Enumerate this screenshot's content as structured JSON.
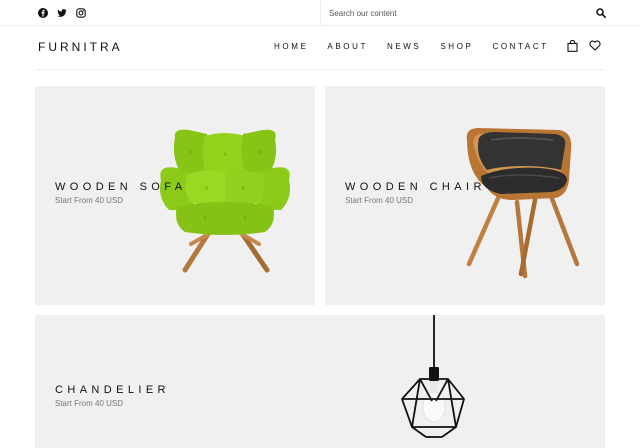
{
  "topbar": {
    "social": [
      "facebook-icon",
      "twitter-icon",
      "instagram-icon"
    ],
    "search": {
      "placeholder": "Search our content",
      "value": ""
    }
  },
  "header": {
    "logo": "FURNITRA",
    "nav": [
      "HOME",
      "ABOUT",
      "NEWS",
      "SHOP",
      "CONTACT"
    ],
    "actions": [
      "shopping-bag-icon",
      "heart-icon"
    ]
  },
  "products": [
    {
      "title": "WOODEN SOFA",
      "subtitle": "Start From 40 USD",
      "image": "green-armchair"
    },
    {
      "title": "WOODEN CHAIR",
      "subtitle": "Start From 40 USD",
      "image": "leather-wooden-chair"
    },
    {
      "title": "CHANDELIER",
      "subtitle": "Start From 40 USD",
      "image": "wire-pendant-lamp"
    }
  ],
  "colors": {
    "card_bg": "#f0f0f0",
    "accent_green": "#8fd11b",
    "wood": "#b5773a",
    "text": "#111111"
  }
}
